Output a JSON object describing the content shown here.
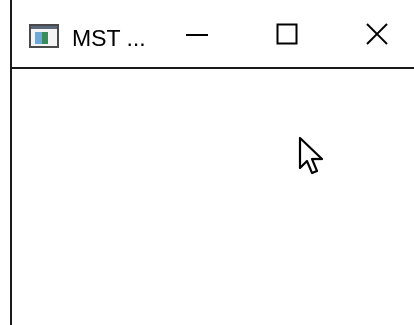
{
  "window": {
    "title": "MST ...",
    "icons": {
      "app": "app-window-icon",
      "minimize": "minimize-icon",
      "maximize": "maximize-icon",
      "close": "close-icon",
      "cursor": "mouse-pointer-icon"
    }
  }
}
